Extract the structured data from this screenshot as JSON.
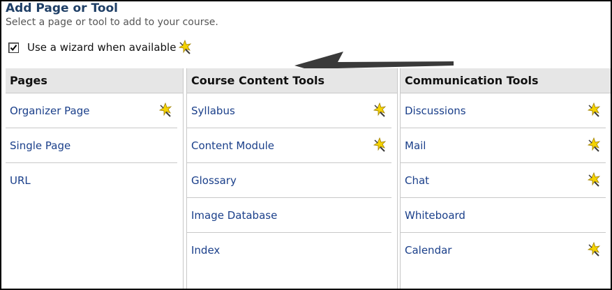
{
  "header": {
    "title": "Add Page or Tool",
    "subtitle": "Select a page or tool to add to your course."
  },
  "wizard_option": {
    "label": "Use a wizard when available",
    "checked": true
  },
  "columns": [
    {
      "header": "Pages",
      "items": [
        {
          "label": "Organizer Page",
          "wizard": true
        },
        {
          "label": "Single Page",
          "wizard": false
        },
        {
          "label": "URL",
          "wizard": false
        }
      ]
    },
    {
      "header": "Course Content Tools",
      "items": [
        {
          "label": "Syllabus",
          "wizard": true
        },
        {
          "label": "Content Module",
          "wizard": true
        },
        {
          "label": "Glossary",
          "wizard": false
        },
        {
          "label": "Image Database",
          "wizard": false
        },
        {
          "label": "Index",
          "wizard": false
        }
      ]
    },
    {
      "header": "Communication Tools",
      "items": [
        {
          "label": "Discussions",
          "wizard": true
        },
        {
          "label": "Mail",
          "wizard": true
        },
        {
          "label": "Chat",
          "wizard": true
        },
        {
          "label": "Whiteboard",
          "wizard": false
        },
        {
          "label": "Calendar",
          "wizard": true
        }
      ]
    }
  ],
  "icons": {
    "wizard": "magic-wand-icon",
    "checkbox_mark": "check-icon",
    "annotation": "arrow-left-icon"
  },
  "colors": {
    "title": "#1f3f66",
    "link": "#1a3f8a",
    "header_bg": "#e6e6e6",
    "wand_star": "#f5d300"
  }
}
